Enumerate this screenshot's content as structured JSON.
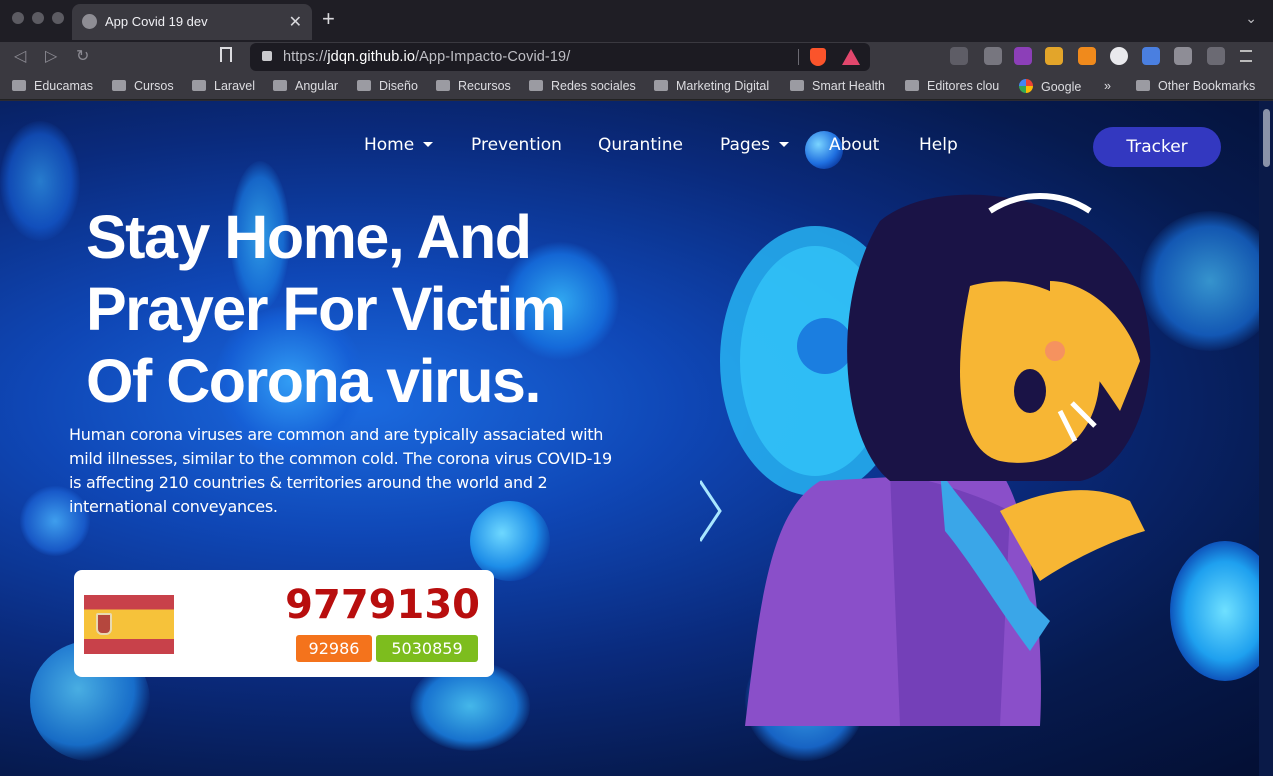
{
  "browser": {
    "tab_title": "App Covid 19 dev",
    "tab_close": "✕",
    "new_tab": "+",
    "url_prefix": "https://",
    "url_host": "jdqn.github.io",
    "url_path": "/App-Impacto-Covid-19/",
    "back": "◁",
    "forward": "▷",
    "reload": "↻",
    "tab_menu": "⌄"
  },
  "bookmarks": {
    "items": [
      "Educamas",
      "Cursos",
      "Laravel",
      "Angular",
      "Diseño",
      "Recursos",
      "Redes sociales",
      "Marketing Digital",
      "Smart Health",
      "Editores clou"
    ],
    "google": "Google",
    "overflow": "»",
    "other": "Other Bookmarks"
  },
  "nav": {
    "home": "Home",
    "prevention": "Prevention",
    "quarantine": "Qurantine",
    "pages": "Pages",
    "about": "About",
    "help": "Help",
    "tracker": "Tracker"
  },
  "hero": {
    "title_line1": "Stay Home, And",
    "title_line2": "Prayer For Victim",
    "title_line3": "Of Corona virus.",
    "description": "Human corona viruses are common and are typically assaciated with mild illnesses, similar to the common cold. The corona virus COVID-19 is affecting 210 countries & territories around the world and 2 international conveyances."
  },
  "stats": {
    "total_cases": "9779130",
    "deaths": "92986",
    "recovered": "5030859"
  },
  "colors": {
    "accent": "#3338c0",
    "cases": "#b80e0e",
    "deaths": "#f4731c",
    "recovered": "#7dbd1e"
  }
}
